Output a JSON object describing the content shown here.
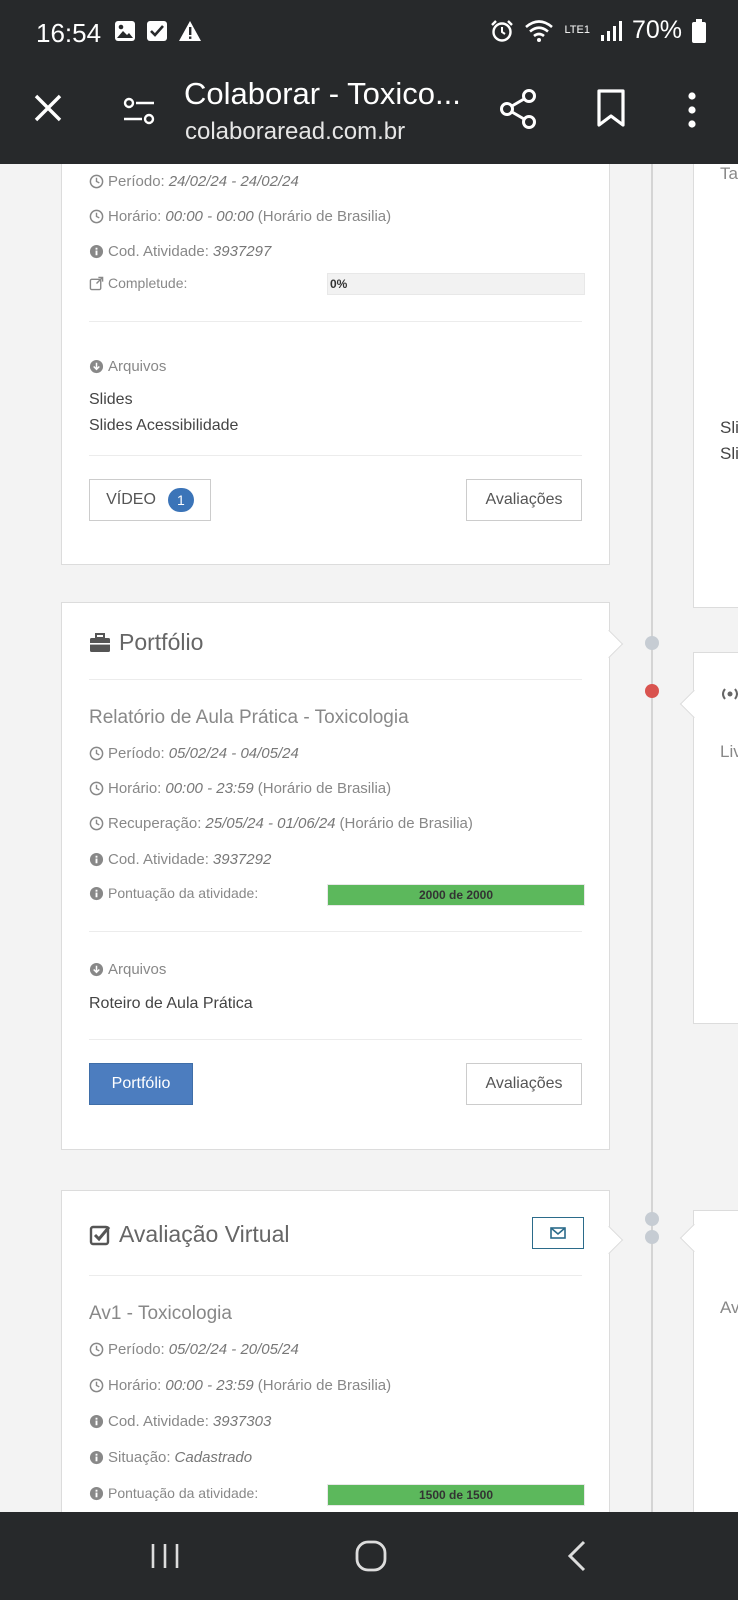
{
  "status_bar": {
    "time": "16:54",
    "battery": "70%",
    "network": "LTE1"
  },
  "browser": {
    "title": "Colaborar - Toxico...",
    "url": "colaboraread.com.br"
  },
  "card1": {
    "periodo_label": "Período:",
    "periodo": "24/02/24 - 24/02/24",
    "horario_label": "Horário:",
    "horario": "00:00 - 00:00",
    "horario_tz": "(Horário de Brasilia)",
    "cod_label": "Cod. Atividade:",
    "cod": "3937297",
    "completude_label": "Completude:",
    "completude_text": "0%",
    "completude_value": 0,
    "arquivos_label": "Arquivos",
    "files": [
      "Slides",
      "Slides Acessibilidade"
    ],
    "video_label": "VÍDEO",
    "video_count": "1",
    "avaliacoes_label": "Avaliações"
  },
  "card2": {
    "section_title": "Portfólio",
    "activity_title": "Relatório de Aula Prática - Toxicologia",
    "periodo_label": "Período:",
    "periodo": "05/02/24 - 04/05/24",
    "horario_label": "Horário:",
    "horario": "00:00 - 23:59",
    "horario_tz": "(Horário de Brasilia)",
    "recuperacao_label": "Recuperação:",
    "recuperacao": "25/05/24 - 01/06/24",
    "recuperacao_tz": "(Horário de Brasilia)",
    "cod_label": "Cod. Atividade:",
    "cod": "3937292",
    "pontuacao_label": "Pontuação da atividade:",
    "pontuacao_text": "2000 de 2000",
    "pontuacao_value": 1.0,
    "arquivos_label": "Arquivos",
    "files": [
      "Roteiro de Aula Prática"
    ],
    "portfolio_button": "Portfólio",
    "avaliacoes_label": "Avaliações"
  },
  "card3": {
    "section_title": "Avaliação Virtual",
    "activity_title": "Av1 - Toxicologia",
    "periodo_label": "Período:",
    "periodo": "05/02/24 - 20/05/24",
    "horario_label": "Horário:",
    "horario": "00:00 - 23:59",
    "horario_tz": "(Horário de Brasilia)",
    "cod_label": "Cod. Atividade:",
    "cod": "3937303",
    "situacao_label": "Situação:",
    "situacao": "Cadastrado",
    "pontuacao_label": "Pontuação da atividade:",
    "pontuacao_text": "1500 de 1500",
    "pontuacao_value": 1.0
  },
  "right_column": {
    "frag1": "Ta",
    "frag2": "Sli",
    "frag3": "Sli",
    "frag4": "Liv",
    "frag5": "Av"
  },
  "colors": {
    "toolbar": "#27292b",
    "primary": "#4c7dbf",
    "success": "#5cb85c",
    "badge": "#3b74b8",
    "alert_dot": "#d9534f"
  }
}
